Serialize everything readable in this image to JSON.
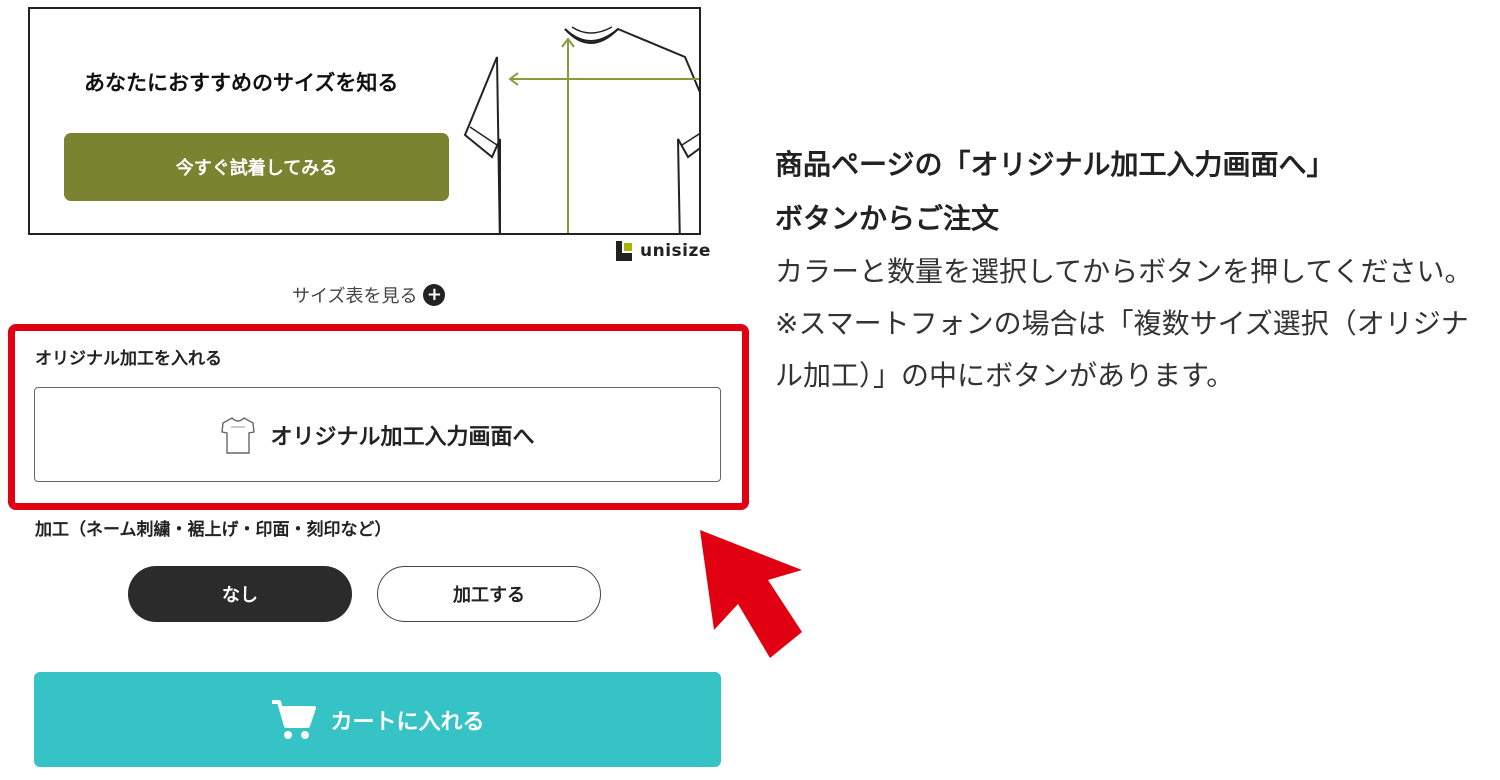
{
  "banner": {
    "heading": "あなたにおすすめのサイズを知る",
    "button_label": "今すぐ試着してみる",
    "button_color": "#7a8430",
    "illustration_icon": "tshirt-measure-icon"
  },
  "unisize": {
    "logo_text": "unisize"
  },
  "size_chart": {
    "link_label": "サイズ表を見る",
    "icon": "plus-circle-icon"
  },
  "original": {
    "section_label": "オリジナル加工を入れる",
    "button_label": "オリジナル加工入力画面へ",
    "button_icon": "tshirt-icon",
    "highlight_color": "#e10012"
  },
  "processing": {
    "label": "加工（ネーム刺繍・裾上げ・印面・刻印など）",
    "options": [
      {
        "label": "なし",
        "selected": true
      },
      {
        "label": "加工する",
        "selected": false
      }
    ]
  },
  "cart": {
    "button_label": "カートに入れる",
    "icon": "cart-icon",
    "color": "#35c3c5"
  },
  "explanation": {
    "title_line1": "商品ページの「オリジナル加工入力画面へ」",
    "title_line2": "ボタンからご注文",
    "body": "カラーと数量を選択してからボタンを押してください。",
    "note": "※スマートフォンの場合は「複数サイズ選択（オリジナル加工）」の中にボタンがあります。"
  }
}
